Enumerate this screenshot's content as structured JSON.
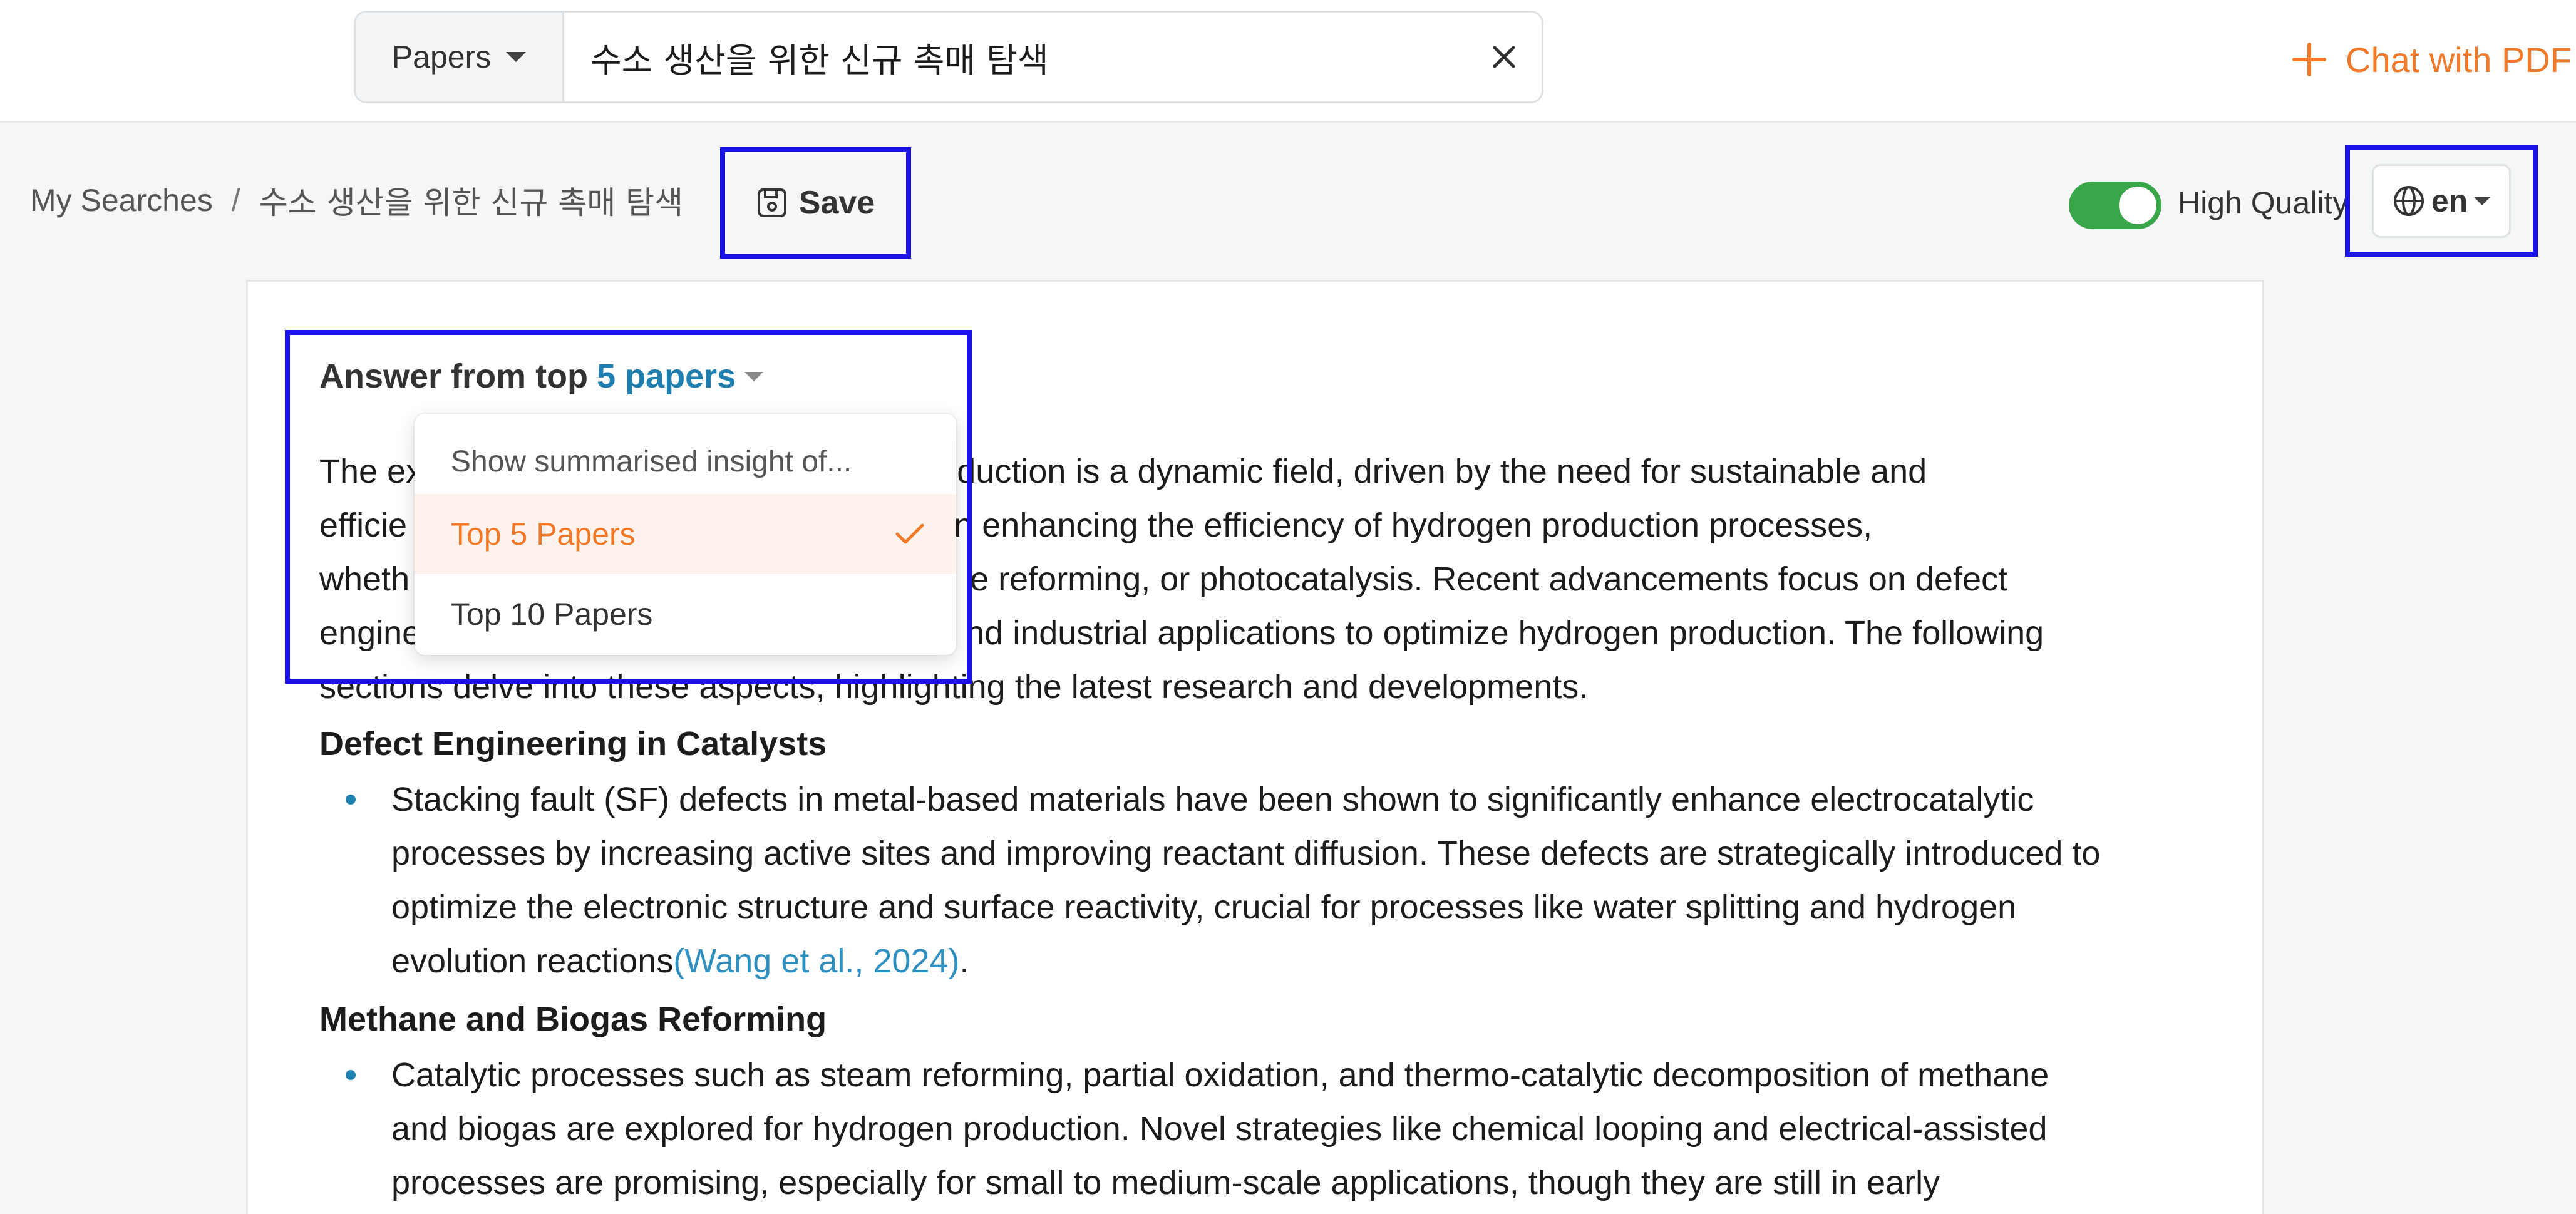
{
  "search": {
    "scope": "Papers",
    "query": "수소 생산을 위한 신규 촉매 탐색"
  },
  "header": {
    "chat_pdf_label": "Chat with PDF"
  },
  "breadcrumb": {
    "root": "My Searches",
    "separator": "/",
    "current": "수소 생산을 위한 신규 촉매 탐색",
    "save_label": "Save"
  },
  "settings": {
    "quality_label": "High Quality",
    "quality_enabled": true,
    "language": "en"
  },
  "answer": {
    "prefix": "Answer from top",
    "count_label": "5 papers",
    "dropdown": {
      "title": "Show summarised insight of...",
      "options": [
        "Top 5 Papers",
        "Top 10 Papers"
      ],
      "selected": "Top 5 Papers"
    },
    "intro_lines": [
      "The ex",
      "ogen production is a dynamic field, driven by the need for sustainable and",
      "efficie",
      "a crucial role in enhancing the efficiency of hydrogen production processes,",
      "wheth",
      "e reforming, or photocatalysis. Recent advancements focus on defect",
      "engine",
      "nd industrial applications to optimize hydrogen production. The following",
      "sections delve into these aspects, highlighting the latest research and developments."
    ],
    "sections": [
      {
        "heading": "Defect Engineering in Catalysts",
        "lines": [
          "Stacking fault (SF) defects in metal-based materials have been shown to significantly enhance electrocatalytic",
          "processes by increasing active sites and improving reactant diffusion. These defects are strategically introduced to",
          "optimize the electronic structure and surface reactivity, crucial for processes like water splitting and hydrogen",
          "evolution reactions"
        ],
        "citation": "(Wang et al., 2024)",
        "end": "."
      },
      {
        "heading": "Methane and Biogas Reforming",
        "lines": [
          "Catalytic processes such as steam reforming, partial oxidation, and thermo-catalytic decomposition of methane",
          "and biogas are explored for hydrogen production. Novel strategies like chemical looping and electrical-assisted",
          "processes are promising, especially for small to medium-scale applications, though they are still in early"
        ]
      }
    ]
  },
  "colors": {
    "accent_orange": "#f07a2a",
    "link_blue": "#1f7fb0",
    "toggle_green": "#3aa64a",
    "highlight_frame": "#1a12e6"
  },
  "icons": {
    "scope_caret": "chevron-down-icon",
    "clear": "close-icon",
    "chat_plus": "plus-icon",
    "save": "save-icon",
    "language": "globe-icon",
    "selected_check": "check-icon"
  }
}
